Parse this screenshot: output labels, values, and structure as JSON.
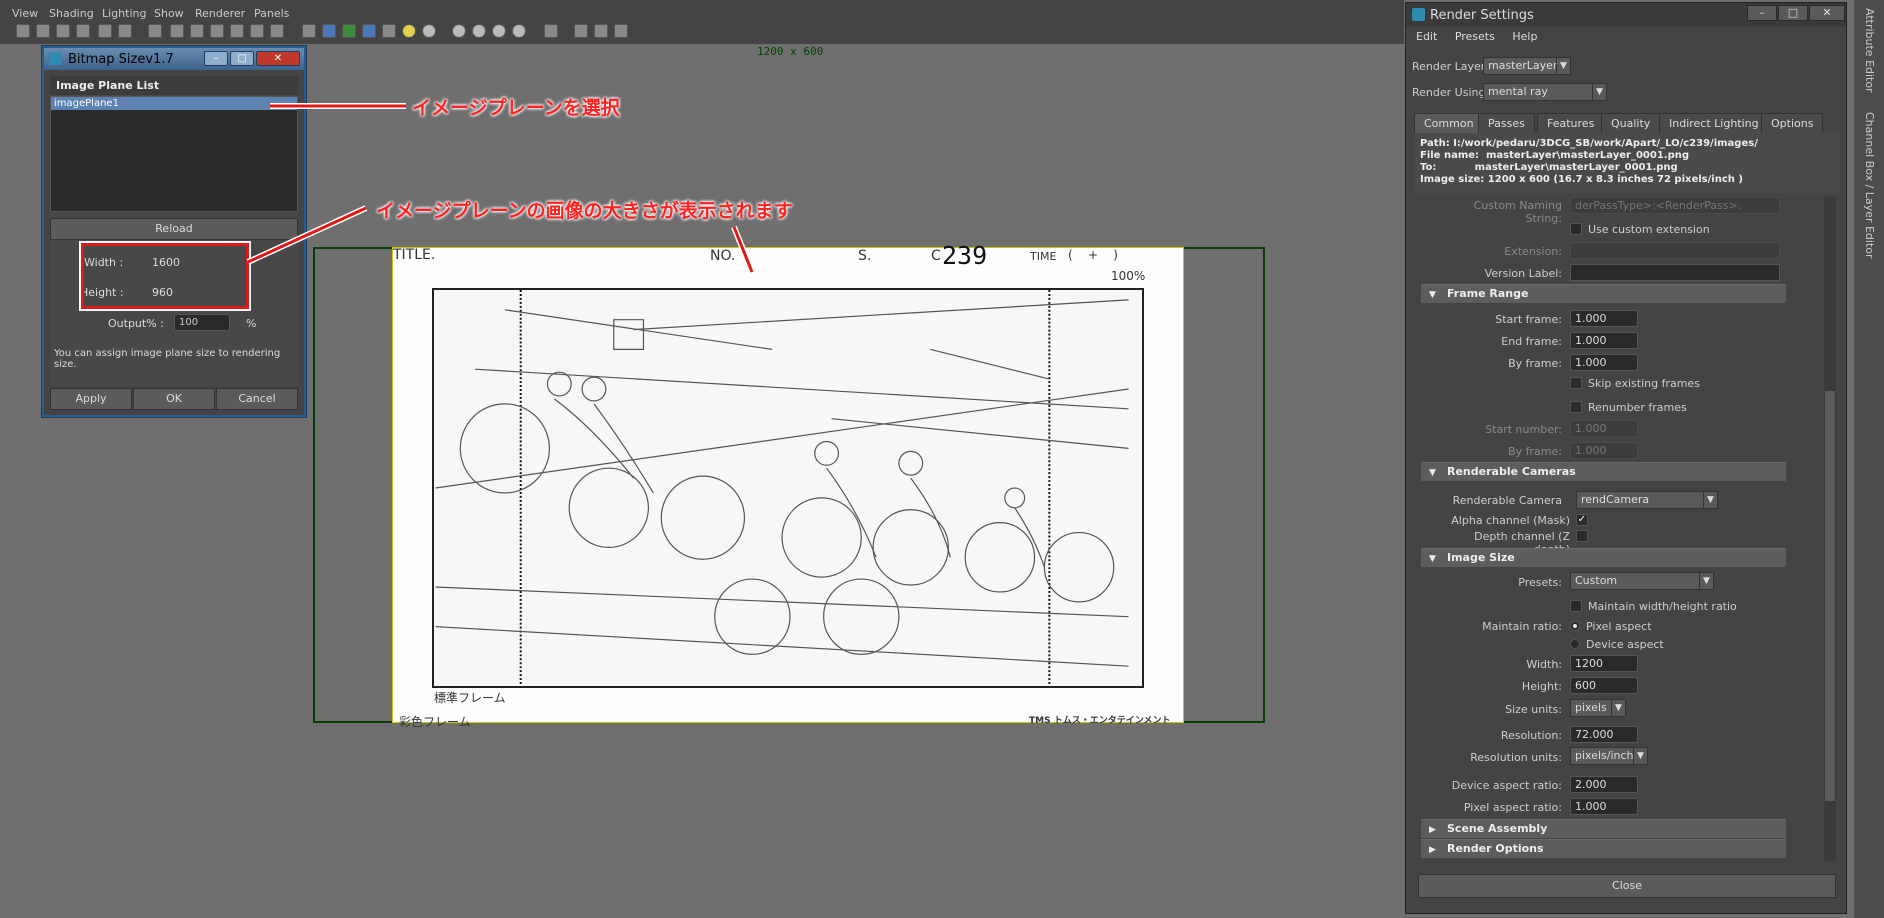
{
  "main_menu": [
    "View",
    "Shading",
    "Lighting",
    "Show",
    "Renderer",
    "Panels"
  ],
  "viewport": {
    "resolution_label": "1200 x 600"
  },
  "storyboard": {
    "title_label": "TITLE.",
    "no_label": "NO.",
    "s_label": "S.",
    "c_label": "C",
    "cut_number": "239",
    "time_label": "TIME",
    "time_parens": "(    +    )",
    "zoom_label": "100%",
    "frame_standard": "標準フレーム",
    "frame_color": "彩色フレーム",
    "logo": "TMS トムス・エンタテインメント"
  },
  "bitmap_window": {
    "title": "Bitmap Sizev1.7",
    "section_label": "Image Plane List",
    "list_items": [
      "imagePlane1"
    ],
    "reload_label": "Reload",
    "width_label": "Width :",
    "width_value": "1600",
    "height_label": "Height :",
    "height_value": "960",
    "output_label": "Output% :",
    "output_value": "100",
    "percent_sign": "%",
    "hint": "You can assign image plane size to rendering size.",
    "apply_label": "Apply",
    "ok_label": "OK",
    "cancel_label": "Cancel"
  },
  "callouts": {
    "select_plane": "イメージプレーンを選択",
    "size_shown": "イメージプレーンの画像の大きさが表示されます"
  },
  "render_settings": {
    "title": "Render Settings",
    "menu": [
      "Edit",
      "Presets",
      "Help"
    ],
    "render_layer_label": "Render Layer",
    "render_layer_value": "masterLayer",
    "render_using_label": "Render Using",
    "render_using_value": "mental ray",
    "tabs": [
      "Common",
      "Passes",
      "Features",
      "Quality",
      "Indirect Lighting",
      "Options"
    ],
    "path_line": "Path: I:/work/pedaru/3DCG_SB/work/Apart/_LO/c239/images/",
    "file_line": "File name:  masterLayer\\masterLayer_0001.png",
    "to_line": "To:           masterLayer\\masterLayer_0001.png",
    "size_line": "Image size: 1200 x 600 (16.7 x 8.3 inches 72 pixels/inch )",
    "custom_naming_label": "Custom Naming String:",
    "custom_naming_value": "derPassType>:<RenderPass>.<Camera>",
    "use_custom_ext_label": "Use custom extension",
    "extension_label": "Extension:",
    "version_label": "Version Label:",
    "frame_range_header": "Frame Range",
    "start_frame_label": "Start frame:",
    "start_frame_value": "1.000",
    "end_frame_label": "End frame:",
    "end_frame_value": "1.000",
    "by_frame_label": "By frame:",
    "by_frame_value": "1.000",
    "skip_existing_label": "Skip existing frames",
    "renumber_label": "Renumber frames",
    "start_number_label": "Start number:",
    "start_number_value": "1.000",
    "by_frame2_label": "By frame:",
    "by_frame2_value": "1.000",
    "cameras_header": "Renderable Cameras",
    "renderable_camera_label": "Renderable Camera",
    "renderable_camera_value": "rendCamera",
    "alpha_label": "Alpha channel (Mask)",
    "depth_label": "Depth channel (Z depth)",
    "image_size_header": "Image Size",
    "presets_label": "Presets:",
    "presets_value": "Custom",
    "maintain_wh_label": "Maintain width/height ratio",
    "maintain_ratio_label": "Maintain ratio:",
    "pixel_aspect_option": "Pixel aspect",
    "device_aspect_option": "Device aspect",
    "width_label": "Width:",
    "width_value": "1200",
    "height_label": "Height:",
    "height_value": "600",
    "size_units_label": "Size units:",
    "size_units_value": "pixels",
    "resolution_label": "Resolution:",
    "resolution_value": "72.000",
    "resolution_units_label": "Resolution units:",
    "resolution_units_value": "pixels/inch",
    "device_aspect_label": "Device aspect ratio:",
    "device_aspect_value": "2.000",
    "pixel_aspect_label": "Pixel aspect ratio:",
    "pixel_aspect_value": "1.000",
    "scene_assembly_header": "Scene Assembly",
    "render_options_header": "Render Options",
    "close_label": "Close"
  },
  "side_panel": [
    "Attribute Editor",
    "Channel Box / Layer Editor"
  ]
}
